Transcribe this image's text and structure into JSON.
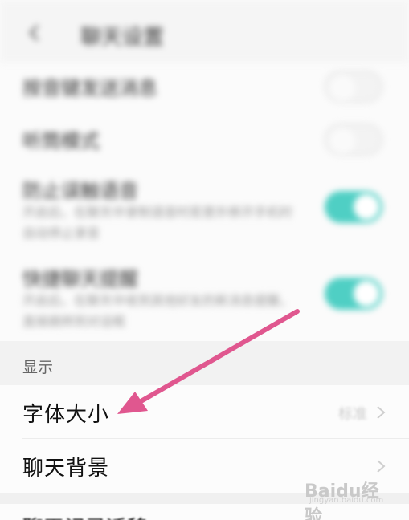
{
  "appbar": {
    "title": "聊天设置",
    "back_icon": "arrow-left-icon"
  },
  "blurred_rows": [
    {
      "title": "按音键发送消息",
      "subtitle": "",
      "toggle_on": false
    },
    {
      "title": "听筒模式",
      "subtitle": "",
      "toggle_on": false
    },
    {
      "title": "防止误触语音",
      "subtitle": "开启后，在聊天中录制语音时若意外移开手机时自动停止录音",
      "toggle_on": true
    },
    {
      "title": "快捷聊天提醒",
      "subtitle": "开启后，在聊天中收到其他好友的新消息提醒，直接跳转到对话框",
      "toggle_on": true
    }
  ],
  "display_section": {
    "header": "显示",
    "items": [
      {
        "label": "字体大小",
        "value": "标准"
      },
      {
        "label": "聊天背景",
        "value": ""
      }
    ]
  },
  "next_row": {
    "label": "聊天记录迁移"
  },
  "colors": {
    "accent": "#4fcfc4",
    "arrow": "#e0578f"
  },
  "watermark": {
    "text": "Baidu经验",
    "sub": "jingyan.baidu.com"
  }
}
